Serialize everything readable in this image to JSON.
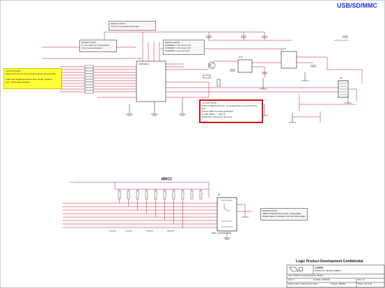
{
  "sheet": {
    "title": "USB/SD/MMC",
    "mmc_label": "MMC2"
  },
  "notes": {
    "design_top": {
      "title": "DESIGN NOTE:",
      "lines": [
        "3.3V IO is generated internally"
      ]
    },
    "design_left": {
      "title": "DESIGN NOTE:",
      "lines": [
        "To use USB, the Transmission",
        "LCD must be disabled"
      ]
    },
    "design_right": {
      "title": "DESIGN NOTE:",
      "lines": [
        "CURRENT = 50 mA at 3.3V",
        "CURRENT = 25 mA at 1.8V",
        "CURRENT = 5 mA at 3.3V"
      ]
    },
    "layout_yellow": {
      "title": "LAYOUT NOTE:",
      "lines": [
        "Place ULPI lines to 5 to 10 and minimize trace lengths",
        "",
        "USB ULPI signals should be trace length matched",
        "with ~4.5ps skew variance"
      ]
    },
    "layout_red": {
      "title": "LAYOUT NOTE:",
      "lines": [
        "USB 2.0 differential lines - terminated with a ring around the pair",
        "Follow USB 2.0 routing guidelines",
        "Length Match = < 150 mil",
        "Differential Impedance: 90 ohms"
      ]
    },
    "design_mmc": {
      "title": "DESIGN NOTE:",
      "lines": [
        "MMC2 INTERFACE IS ONLY AVAILABLE",
        "WHEN MMC2 CONNECTOR IS POPULATED"
      ]
    }
  },
  "title_block": {
    "confidential": "Logic Product Development Confidential",
    "company": "LOGIC",
    "company_sub": "PRODUCT DEVELOPMENT",
    "doc_title": "Title: AM3517 EVM Application Board",
    "size_label": "Size: C",
    "number_label": "Number: 1016191",
    "rev_label": "Rev.: A",
    "date_label": "Wednesday, February 24, 2010",
    "project_label": "Project: AM3517",
    "sheet_label": "Sheet: 16 of 24"
  },
  "parts": {
    "u_main": "U18",
    "u_main_desc": "USB3320C",
    "u_reg": "U19",
    "u_sw": "U20",
    "u_usb": "J6",
    "u_mmc": "J8",
    "u_mmc_desc": "MMC_CONNECTOR"
  },
  "colors": {
    "wire": "#c0102a",
    "body": "#1a1a1a",
    "title": "#1a2fcc",
    "note_red": "#d11111",
    "note_yellow": "#ffff33"
  }
}
